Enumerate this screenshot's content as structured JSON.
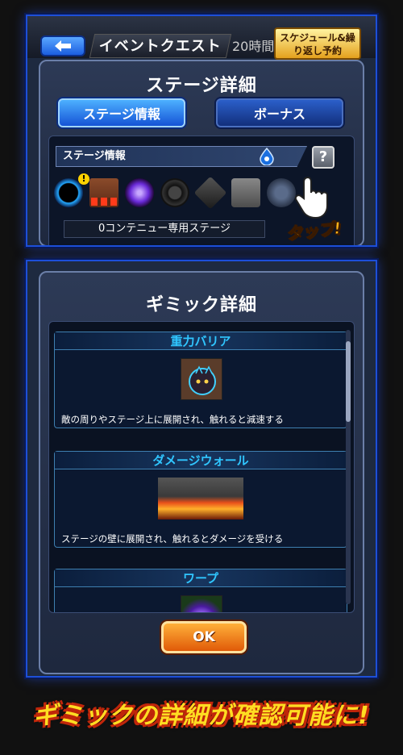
{
  "top_panel": {
    "quest_title": "イベントクエスト",
    "time_text": "20時間",
    "schedule_badge": "スケジュール&繰り返し予約",
    "dialog_title": "ステージ詳細",
    "tabs": [
      {
        "label": "ステージ情報",
        "active": true
      },
      {
        "label": "ボーナス",
        "active": false
      }
    ],
    "info_header": "ステージ情報",
    "help_label": "?",
    "warning_mark": "!",
    "continue_text": "0コンテニュー専用ステージ",
    "tap_label": "タップ!",
    "gimmick_icons": [
      "gravity-barrier-icon",
      "damage-wall-icon",
      "warp-icon",
      "mine-icon",
      "block-icon",
      "panel-icon",
      "enemy-icon"
    ]
  },
  "bottom_panel": {
    "dialog_title": "ギミック詳細",
    "gimmicks": [
      {
        "name": "重力バリア",
        "description": "敵の周りやステージ上に展開され、触れると減速する"
      },
      {
        "name": "ダメージウォール",
        "description": "ステージの壁に展開され、触れるとダメージを受ける"
      },
      {
        "name": "ワープ",
        "description": ""
      }
    ],
    "ok_label": "OK"
  },
  "caption": "ギミックの詳細が確認可能に!",
  "colors": {
    "panel_border": "#1d4fd8",
    "tab_active": "#1553d6",
    "gimmick_title": "#30c6ff",
    "ok_button": "#e05a08",
    "caption": "#ffdd22"
  }
}
